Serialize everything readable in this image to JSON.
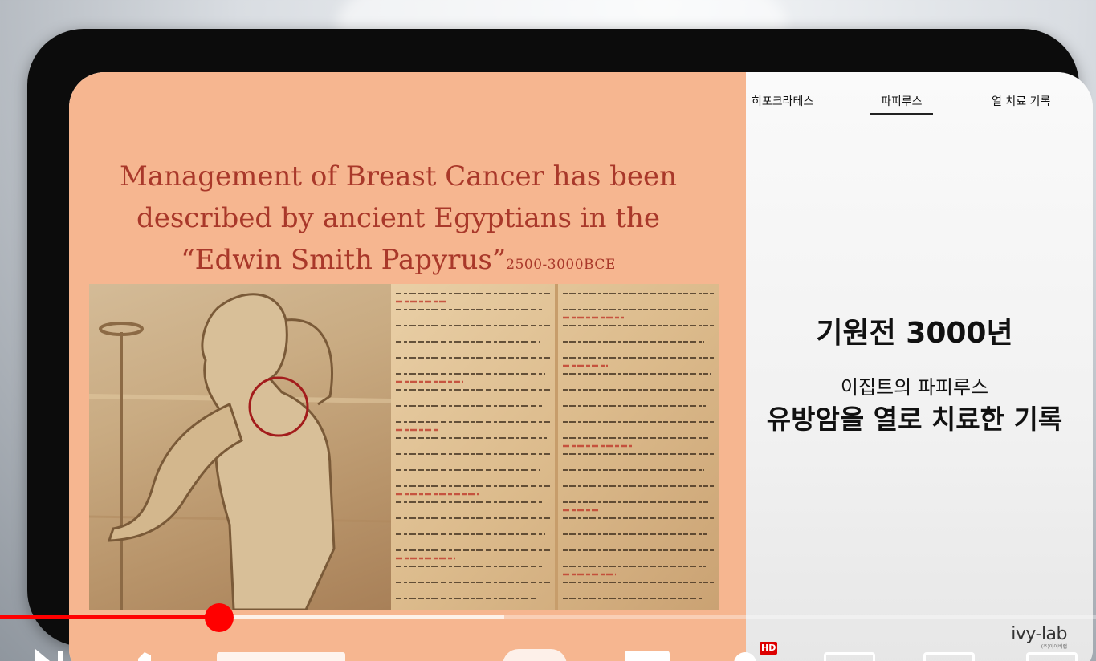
{
  "slide": {
    "title_line1": "Management of Breast Cancer has been",
    "title_line2": "described by ancient Egyptians in the",
    "title_line3": "“Edwin Smith Papyrus”",
    "title_date": "2500-3000BCE"
  },
  "side_panel": {
    "tabs": [
      {
        "label": "히포크라테스",
        "active": false
      },
      {
        "label": "파피루스",
        "active": true
      },
      {
        "label": "열 치료 기록",
        "active": false
      }
    ],
    "headline": "기원전 3000년",
    "subheadline": "이집트의 파피루스",
    "headline2": "유방암을 열로 치료한 기록",
    "brand": "ivy-lab",
    "brand_sub": "(주)아이비랩"
  },
  "player": {
    "progress_fraction": 0.2,
    "buffer_fraction": 0.46,
    "hd_badge": "HD"
  },
  "colors": {
    "slide_bg": "#f6b690",
    "title_red": "#a9382a",
    "progress_red": "#ff0000"
  }
}
